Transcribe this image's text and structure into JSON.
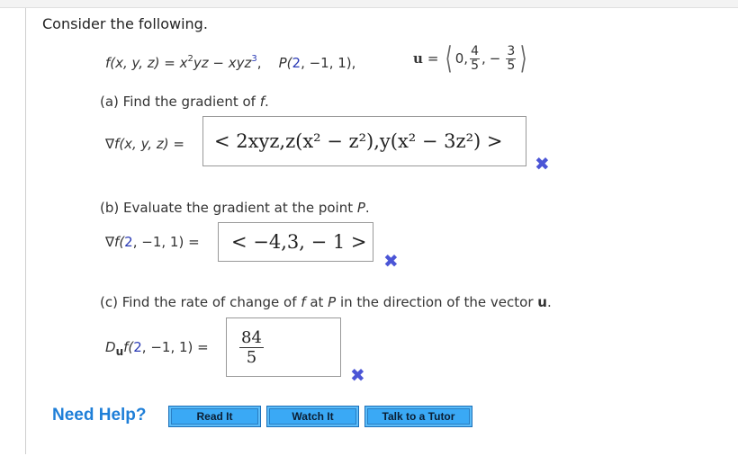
{
  "intro": "Consider the following.",
  "problem": {
    "f_lhs": "f(x, y, z) = x",
    "f_exp1": "2",
    "f_mid": "yz − xyz",
    "f_exp2": "3",
    "f_end": ",",
    "p_label": "P(",
    "p_x": "2",
    "p_rest": ", −1, 1),",
    "u_label": "u",
    "u_eq": "=",
    "u_first": "0,",
    "u_frac1_num": "4",
    "u_frac1_den": "5",
    "u_sep": ",",
    "u_minus": "−",
    "u_frac2_num": "3",
    "u_frac2_den": "5"
  },
  "part_a": {
    "prompt_prefix": "(a) Find the gradient of ",
    "prompt_var": "f",
    "prompt_suffix": ".",
    "lhs": "∇f(x, y, z) =",
    "answer": "< 2xyz,z(x² − z²),y(x² − 3z²) >",
    "status_icon": "✖",
    "status": "incorrect"
  },
  "part_b": {
    "prompt_prefix": "(b) Evaluate the gradient at the point ",
    "prompt_var": "P",
    "prompt_suffix": ".",
    "lhs_prefix": "∇f(",
    "lhs_x": "2",
    "lhs_suffix": ", −1, 1) =",
    "answer": "< −4,3, − 1 >",
    "status_icon": "✖",
    "status": "incorrect"
  },
  "part_c": {
    "prompt_prefix": "(c) Find the rate of change of ",
    "prompt_var1": "f",
    "prompt_mid": " at ",
    "prompt_var2": "P",
    "prompt_mid2": " in the direction of the vector ",
    "prompt_vec": "u",
    "prompt_suffix": ".",
    "lhs_d": "D",
    "lhs_sub": "u",
    "lhs_f": "f(",
    "lhs_x": "2",
    "lhs_suffix": ", −1, 1) =",
    "answer_num": "84",
    "answer_den": "5",
    "status_icon": "✖",
    "status": "incorrect"
  },
  "help": {
    "label": "Need Help?",
    "buttons": [
      "Read It",
      "Watch It",
      "Talk to a Tutor"
    ]
  },
  "colors": {
    "accent_blue": "#1f7fd8",
    "button_blue": "#3aa9f5",
    "incorrect_mark": "#4b55d6",
    "highlight_number": "#2a3ab5"
  }
}
